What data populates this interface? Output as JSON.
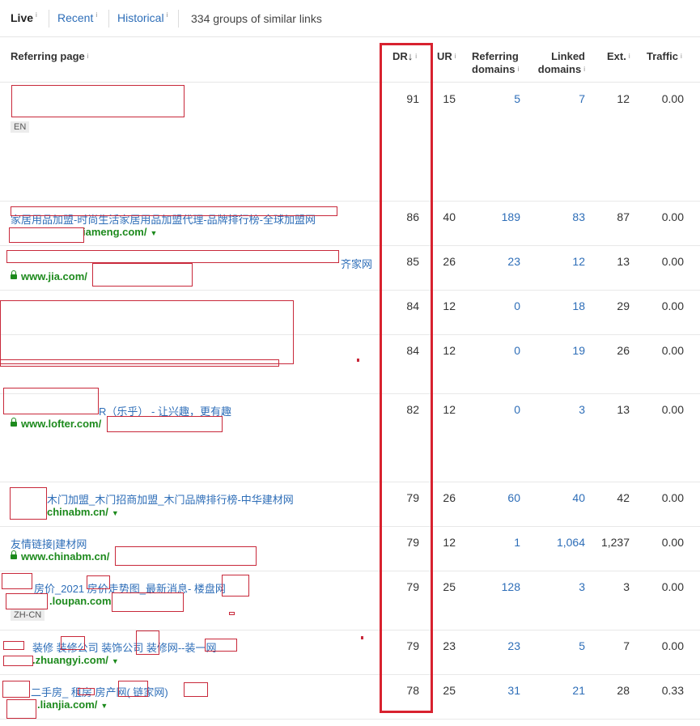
{
  "tabs": {
    "live": "Live",
    "recent": "Recent",
    "historical": "Historical",
    "info": "i",
    "groups_text": "334 groups of similar links"
  },
  "headers": {
    "referring_page": "Referring page",
    "dr": "DR",
    "dr_sort": "↓",
    "ur": "UR",
    "referring_domains_1": "Referring",
    "referring_domains_2": "domains",
    "linked_domains_1": "Linked",
    "linked_domains_2": "domains",
    "ext": "Ext.",
    "traffic": "Traffic",
    "info": "i"
  },
  "rows": [
    {
      "title": "",
      "domain": "",
      "lang": "EN",
      "dr": "91",
      "ur": "15",
      "ref_domains": "5",
      "linked_domains": "7",
      "ext": "12",
      "traffic": "0.00"
    },
    {
      "title": "家居用品加盟-时尚生活家居用品加盟代理-品牌排行榜-全球加盟网",
      "domain": "iameng.com/",
      "lang": "",
      "dr": "86",
      "ur": "40",
      "ref_domains": "189",
      "linked_domains": "83",
      "ext": "87",
      "traffic": "0.00"
    },
    {
      "title": "齐家网",
      "domain": "www.jia.com/",
      "lang": "",
      "dr": "85",
      "ur": "26",
      "ref_domains": "23",
      "linked_domains": "12",
      "ext": "13",
      "traffic": "0.00"
    },
    {
      "title": "",
      "domain": "",
      "lang": "",
      "dr": "84",
      "ur": "12",
      "ref_domains": "0",
      "linked_domains": "18",
      "ext": "29",
      "traffic": "0.00"
    },
    {
      "title": "",
      "domain": "",
      "lang": "",
      "dr": "84",
      "ur": "12",
      "ref_domains": "0",
      "linked_domains": "19",
      "ext": "26",
      "traffic": "0.00"
    },
    {
      "title": "R（乐乎） - 让兴趣，更有趣",
      "domain": "www.lofter.com/",
      "lang": "",
      "dr": "82",
      "ur": "12",
      "ref_domains": "0",
      "linked_domains": "3",
      "ext": "13",
      "traffic": "0.00"
    },
    {
      "title": "木门加盟_木门招商加盟_木门品牌排行榜-中华建材网",
      "domain": "chinabm.cn/",
      "lang": "",
      "dr": "79",
      "ur": "26",
      "ref_domains": "60",
      "linked_domains": "40",
      "ext": "42",
      "traffic": "0.00"
    },
    {
      "title": "友情链接|建材网",
      "domain": "www.chinabm.cn/",
      "lang": "",
      "dr": "79",
      "ur": "12",
      "ref_domains": "1",
      "linked_domains": "1,064",
      "ext": "1,237",
      "traffic": "0.00"
    },
    {
      "title": "房价_2021 房价走势图_最新消息- 楼盘网",
      "domain": ".loupan.com",
      "lang": "ZH-CN",
      "dr": "79",
      "ur": "25",
      "ref_domains": "128",
      "linked_domains": "3",
      "ext": "3",
      "traffic": "0.00"
    },
    {
      "title": "装修 装修公司 装饰公司 装修网--装一网",
      "domain": ".zhuangyi.com/",
      "lang": "",
      "dr": "79",
      "ur": "23",
      "ref_domains": "23",
      "linked_domains": "5",
      "ext": "7",
      "traffic": "0.00"
    },
    {
      "title": "二手房_ 租房 房产网( 链家网)",
      "domain": ".lianjia.com/",
      "lang": "",
      "dr": "78",
      "ur": "25",
      "ref_domains": "31",
      "linked_domains": "21",
      "ext": "28",
      "traffic": "0.33"
    }
  ]
}
